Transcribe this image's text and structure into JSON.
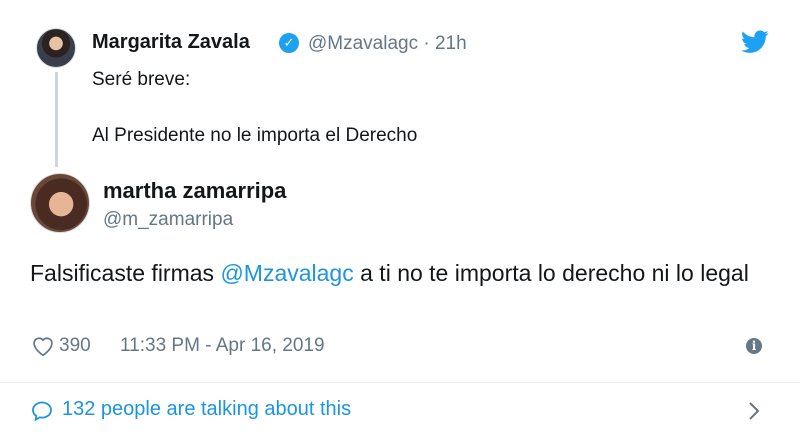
{
  "quoted_tweet": {
    "author_name": "Margarita Zavala",
    "verified": true,
    "meta": "@Mzavalagc · 21h",
    "text": "Seré breve:\n\nAl Presidente no le importa el Derecho"
  },
  "reply_tweet": {
    "author_name": "martha zamarripa",
    "handle": "@m_zamarripa",
    "text_before": "Falsificaste firmas ",
    "mention": "@Mzavalagc",
    "text_after": " a ti no te importa lo derecho ni lo legal",
    "likes": "390",
    "timestamp": "11:33 PM - Apr 16, 2019"
  },
  "footer": {
    "talking_label": "132 people are talking about this"
  },
  "icons": {
    "brand": "twitter-bird-icon",
    "verified": "verified-badge-icon",
    "like": "heart-icon",
    "info": "info-icon",
    "conversation": "speech-bubble-icon",
    "chevron": "chevron-right-icon"
  },
  "colors": {
    "brand": "#1da1f2",
    "link": "#1b95e0",
    "secondary_text": "#657786",
    "primary_text": "#14171a"
  }
}
